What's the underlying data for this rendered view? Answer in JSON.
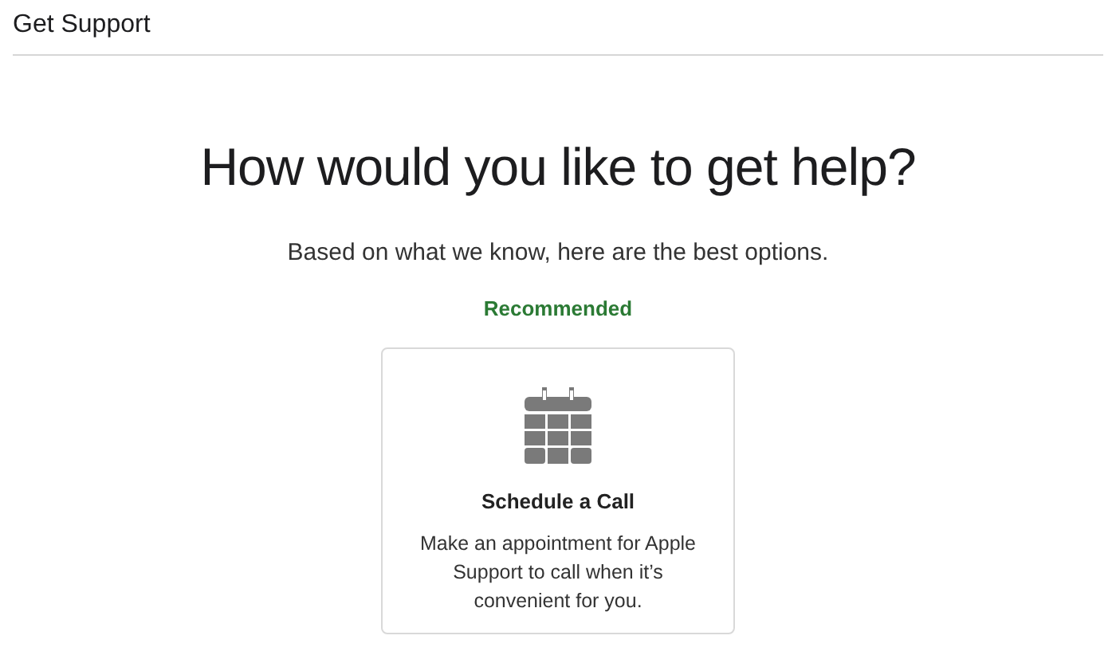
{
  "header": {
    "title": "Get Support"
  },
  "heading": "How would you like to get help?",
  "subtitle": "Based on what we know, here are the best options.",
  "section_label": "Recommended",
  "options": [
    {
      "kind": "calendar",
      "title": "Schedule a Call",
      "description": "Make an appointment for Apple Support to call when it’s convenient for you."
    }
  ]
}
